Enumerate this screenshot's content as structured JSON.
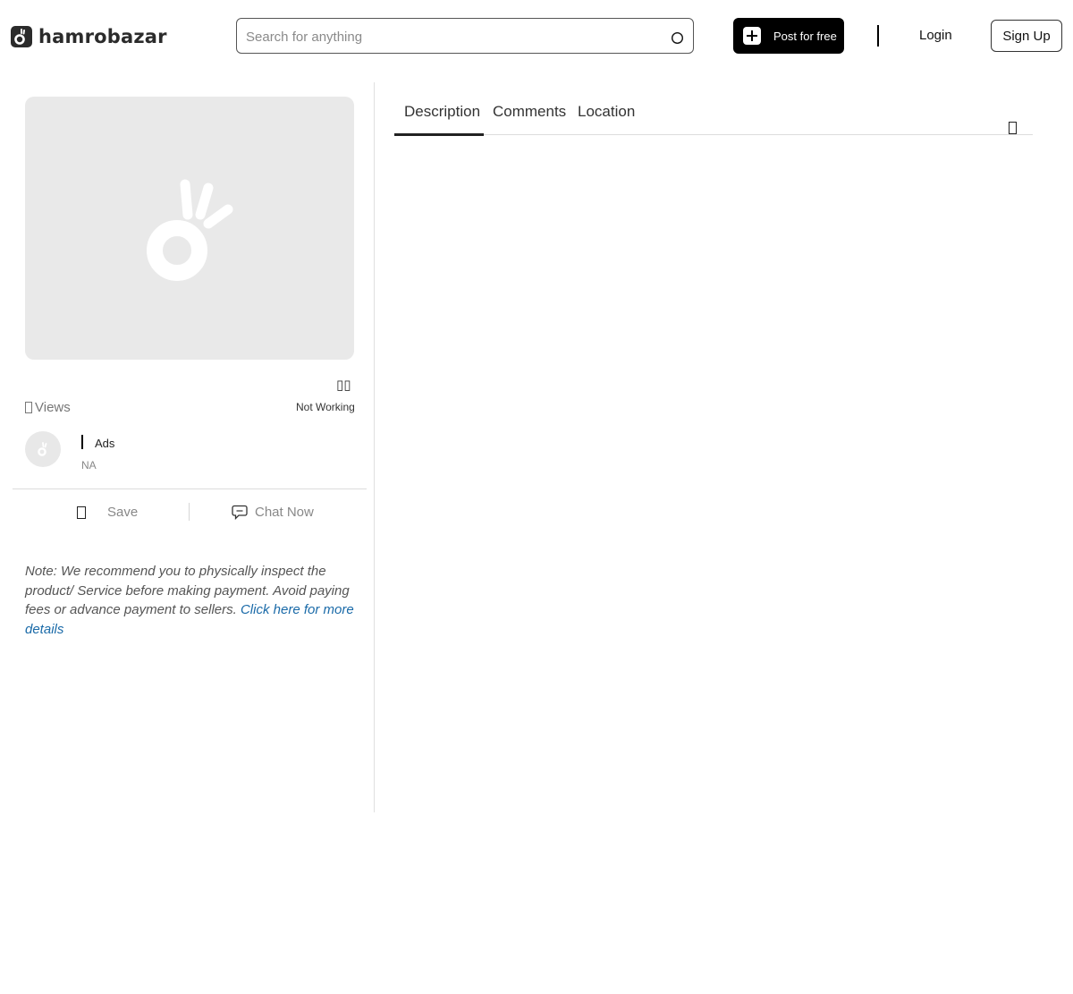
{
  "header": {
    "brand": "hamrobazar",
    "search_placeholder": "Search for anything",
    "post_label": "Post for free",
    "login_label": "Login",
    "signup_label": "Sign Up"
  },
  "listing": {
    "views_label": "Views",
    "status": "Not Working",
    "glyphs": "▯▯"
  },
  "seller": {
    "ads_label": "Ads",
    "location": "NA"
  },
  "actions": {
    "save_label": "Save",
    "chat_label": "Chat Now"
  },
  "note": {
    "text": "Note: We recommend you to physically inspect the product/ Service before making payment. Avoid paying fees or advance payment to sellers. ",
    "link": "Click here for more details"
  },
  "tabs": [
    {
      "label": "Description",
      "active": true
    },
    {
      "label": "Comments",
      "active": false
    },
    {
      "label": "Location",
      "active": false
    }
  ],
  "icons": {
    "logo": "hamrobazar-logo-icon",
    "search": "search-icon",
    "post": "plus-icon",
    "views": "eye-icon",
    "save": "bookmark-icon",
    "chat": "chat-bubble-icon",
    "share": "share-icon",
    "placeholder": "hamrobazar-placeholder-icon"
  },
  "colors": {
    "primary_button": "#000000",
    "link": "#1a6aa8",
    "image_placeholder": "#e9e9e9"
  }
}
